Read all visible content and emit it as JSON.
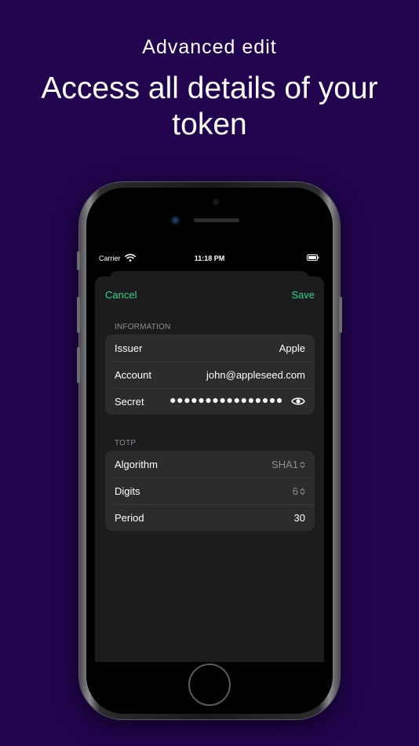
{
  "promo": {
    "subtitle": "Advanced edit",
    "headline": "Access all details of your token"
  },
  "status_bar": {
    "carrier": "Carrier",
    "time": "11:18 PM"
  },
  "nav": {
    "cancel_label": "Cancel",
    "save_label": "Save"
  },
  "information": {
    "title": "INFORMATION",
    "issuer_label": "Issuer",
    "issuer_value": "Apple",
    "account_label": "Account",
    "account_value": "john@appleseed.com",
    "secret_label": "Secret",
    "secret_value": "●●●●●●●●●●●●●●●●"
  },
  "totp": {
    "title": "TOTP",
    "algorithm_label": "Algorithm",
    "algorithm_value": "SHA1",
    "digits_label": "Digits",
    "digits_value": "6",
    "period_label": "Period",
    "period_value": "30"
  },
  "colors": {
    "background": "#21044d",
    "accent": "#32d28a",
    "sheet": "#1c1c1e",
    "row": "#2c2c2e"
  },
  "icons": [
    "wifi-icon",
    "battery-icon",
    "eye-icon",
    "chevron-updown-icon"
  ]
}
